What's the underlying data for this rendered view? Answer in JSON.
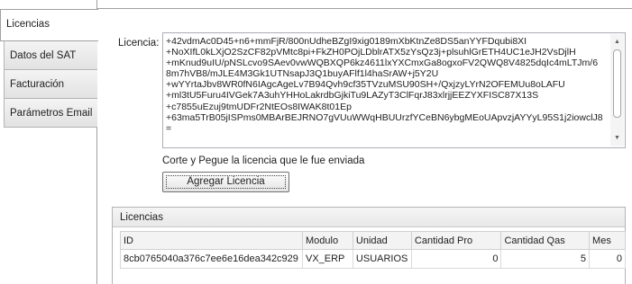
{
  "tabs": [
    {
      "label": "Licencias",
      "active": true
    },
    {
      "label": "Datos del SAT",
      "active": false
    },
    {
      "label": "Facturación",
      "active": false
    },
    {
      "label": "Parámetros Email",
      "active": false
    }
  ],
  "form": {
    "licencia_label": "Licencia:",
    "licencia_value": "+42vdmAc0D45+n6+mmFjR/800nUdheBZgI9xig0189mXbKtnZe8DS5anYYFDqubi8XI\n+NoXIfL0kLXjO2SzCF82pVMtc8pi+FkZH0POjLDblrATX5zYsQz3j+plsuhlGrETH4UC1eJH2VsDjlH\n+mKnud9uIU/pNSLcvo9SAev0vwWQBXQP6kz4611lxYXCmxGa8ogxoFV2QWQ8V4825dqIc4mLTJm/6\n8m7hVB8/mJLE4M3Gk1UTNsapJ3Q1buyAFlf1l4haSrAW+j5Y2U\n+wYYrtaJbv8WR0fN6IAgcAgeLv7B94Qvh9cf35TVzuMSU90SH+/QxjzyLYrN2OFEMUu8oLAFU\n+ml3tU5Furu4IVGek7A3uhYHHoLakrdbGjkiTu9LAZyT3ClFqrJ83xlrjjEEZYXFISC87X13S\n+c7855uEzuj9tmUDFr2NtEOs8IWAK8t01Ep\n+63ma5TrB05jISPms0MBArBEJRNO7gVUuWWqHBUUrzfYCeBN6ybgMEoUApvzjAYYyL95S1j2iowclJ8\n=",
    "hint": "Corte y Pegue la licencia que le fue enviada",
    "add_button": "Agregar Licencia"
  },
  "grid": {
    "title": "Licencias",
    "columns": [
      "ID",
      "Modulo",
      "Unidad",
      "Cantidad Pro",
      "Cantidad Qas",
      "Mes"
    ],
    "rows": [
      [
        "8cb0765040a376c7ee6e16dea342c929",
        "VX_ERP",
        "USUARIOS",
        "0",
        "5",
        "0"
      ]
    ]
  },
  "colors": {
    "border": "#a0a0a0",
    "tab_bg": "#e2e2e2",
    "active_tab_bg": "#ffffff"
  }
}
